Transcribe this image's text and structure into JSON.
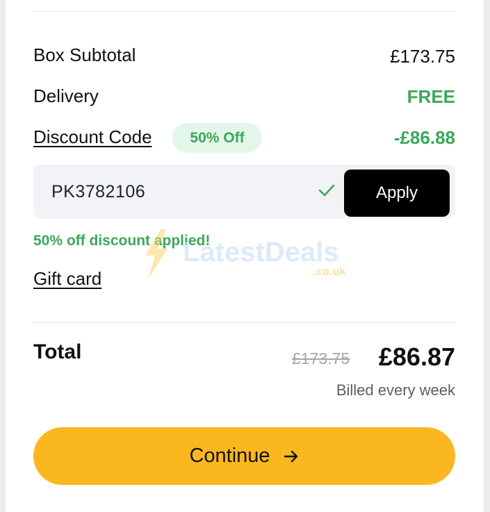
{
  "summary": {
    "subtotal_label": "Box Subtotal",
    "subtotal_value": "£173.75",
    "delivery_label": "Delivery",
    "delivery_value": "FREE",
    "discount_label": "Discount Code",
    "discount_badge": "50% Off",
    "discount_value": "-£86.88"
  },
  "discount_code": {
    "value": "PK3782106",
    "status_icon": "check-icon",
    "apply_label": "Apply",
    "applied_message": "50% off discount applied!"
  },
  "gift_card": {
    "label": "Gift card"
  },
  "watermark": {
    "brand": "LatestDeals",
    "domain": ".co.uk"
  },
  "total": {
    "label": "Total",
    "original_price": "£173.75",
    "price": "£86.87",
    "billing_note": "Billed every week"
  },
  "continue": {
    "label": "Continue",
    "icon": "arrow-right-icon"
  },
  "colors": {
    "accent_green": "#3aa85a",
    "badge_bg": "#e4f6ea",
    "continue_button": "#fbb71f",
    "apply_button": "#000000"
  }
}
